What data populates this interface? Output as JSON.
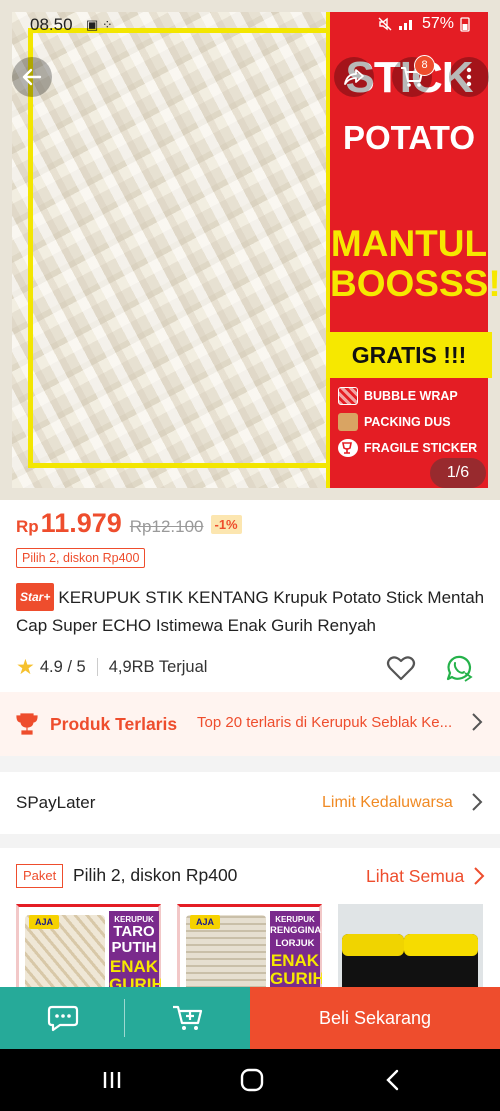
{
  "status_bar": {
    "time": "08.50",
    "left_icons": "▣ ⁘",
    "battery": "57%"
  },
  "hero": {
    "headline_1": "STICK",
    "headline_2": "POTATO",
    "slogan_1": "MANTUL",
    "slogan_2": "BOOSSS!",
    "gratis": "GRATIS !!!",
    "perks": [
      "BUBBLE WRAP",
      "PACKING DUS",
      "FRAGILE STICKER"
    ],
    "cart_count": "8",
    "image_counter": "1/6"
  },
  "price": {
    "currency": "Rp",
    "current": "11.979",
    "original": "Rp12.100",
    "discount": "-1%",
    "bundle_tag": "Pilih 2, diskon Rp400"
  },
  "product": {
    "badge": "Star+",
    "title": "KERUPUK STIK KENTANG Krupuk Potato Stick Mentah Cap Super ECHO Istimewa Enak Gurih Renyah",
    "rating": "4.9 / 5",
    "sold": "4,9RB Terjual"
  },
  "best_seller": {
    "title": "Produk Terlaris",
    "desc": "Top 20 terlaris di Kerupuk Seblak Ke..."
  },
  "paylater": {
    "label": "SPayLater",
    "value": "Limit Kedaluwarsa"
  },
  "bundle": {
    "tag": "Paket",
    "title": "Pilih 2, diskon Rp400",
    "see_all": "Lihat Semua",
    "items": [
      {
        "brand": "AJA",
        "small": "KERUPUK",
        "line1": "TARO PUTIH",
        "line2": "ENAK GURIH"
      },
      {
        "brand": "AJA",
        "small": "KERUPUK",
        "line1": "RENGGINANG LORJUK",
        "line2": "ENAK GURIH"
      },
      {
        "brand": "",
        "small": "",
        "line1": "",
        "line2": ""
      }
    ]
  },
  "action_bar": {
    "buy_label": "Beli Sekarang"
  },
  "colors": {
    "accent": "#ee4d2d",
    "teal": "#26aa99",
    "promo_red": "#e41d24",
    "promo_yellow": "#f3e600"
  },
  "icons": [
    "back-arrow-icon",
    "share-icon",
    "cart-icon",
    "more-vertical-icon",
    "star-icon",
    "heart-icon",
    "whatsapp-icon",
    "trophy-icon",
    "chevron-right-icon",
    "chat-icon",
    "add-to-cart-icon",
    "recents-icon",
    "home-icon",
    "back-icon"
  ]
}
